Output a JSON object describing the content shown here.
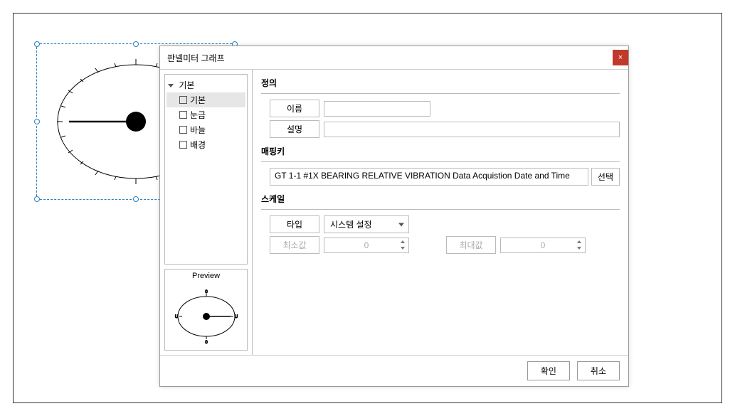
{
  "dialog": {
    "title": "판넬미터 그래프",
    "close_icon": "×"
  },
  "tree": {
    "root": "기본",
    "items": [
      {
        "label": "기본",
        "selected": true
      },
      {
        "label": "눈금",
        "selected": false
      },
      {
        "label": "바늘",
        "selected": false
      },
      {
        "label": "배경",
        "selected": false
      }
    ]
  },
  "preview": {
    "title": "Preview"
  },
  "sections": {
    "definition": {
      "title": "정의",
      "name_label": "이름",
      "name_value": "",
      "desc_label": "설명",
      "desc_value": ""
    },
    "mapping": {
      "title": "매핑키",
      "value": "GT 1-1 #1X BEARING RELATIVE VIBRATION Data Acquistion Date and Time",
      "select_btn": "선택"
    },
    "scale": {
      "title": "스케일",
      "type_label": "타입",
      "type_value": "시스템 설정",
      "min_label": "최소값",
      "min_value": "0",
      "max_label": "최대값",
      "max_value": "0"
    }
  },
  "footer": {
    "ok": "확인",
    "cancel": "취소"
  }
}
